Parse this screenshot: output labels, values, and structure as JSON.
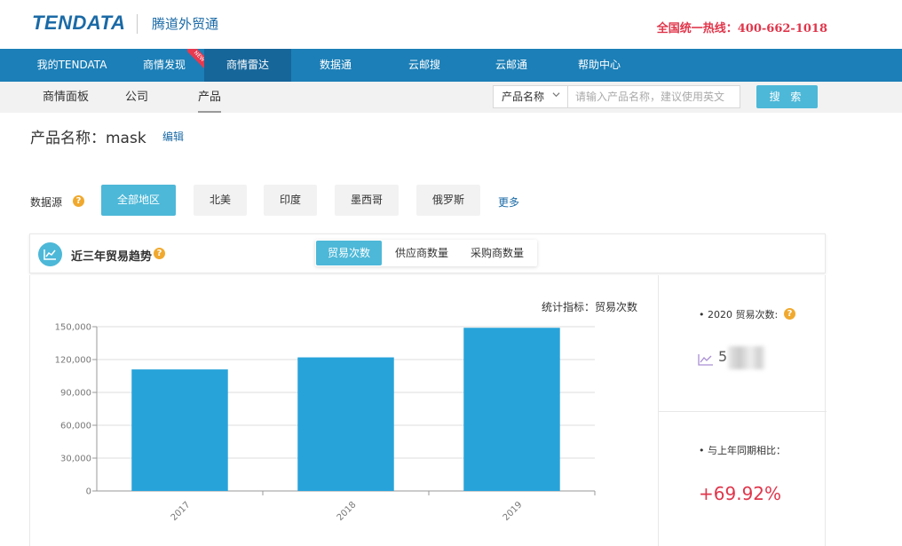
{
  "header": {
    "logo_text": "TENDATA",
    "brand_cn": "腾道外贸通",
    "hotline_label": "全国统一热线：",
    "hotline_number": "400-662-1018",
    "hotline_color": "#e0364b"
  },
  "main_nav": {
    "items": [
      {
        "label": "我的TENDATA"
      },
      {
        "label": "商情发现",
        "badge": "NEW"
      },
      {
        "label": "商情雷达",
        "active": true
      },
      {
        "label": "数据通"
      },
      {
        "label": "云邮搜"
      },
      {
        "label": "云邮通"
      },
      {
        "label": "帮助中心"
      }
    ],
    "color": "#1c7fb7"
  },
  "sub_nav": {
    "items": [
      {
        "label": "商情面板"
      },
      {
        "label": "公司"
      },
      {
        "label": "产品",
        "active": true
      }
    ]
  },
  "search": {
    "select_value": "产品名称",
    "placeholder": "请输入产品名称，建议使用英文",
    "button_label": "搜 索"
  },
  "product": {
    "title": "产品名称：mask",
    "edit_label": "编辑"
  },
  "data_source": {
    "label": "数据源",
    "regions": [
      {
        "label": "全部地区",
        "active": true
      },
      {
        "label": "北美"
      },
      {
        "label": "印度"
      },
      {
        "label": "墨西哥"
      },
      {
        "label": "俄罗斯"
      }
    ],
    "more_label": "更多"
  },
  "trend": {
    "title": "近三年贸易趋势",
    "tabs": [
      {
        "label": "贸易次数",
        "active": true
      },
      {
        "label": "供应商数量"
      },
      {
        "label": "采购商数量"
      }
    ],
    "stat_label": "统计指标：贸易次数"
  },
  "chart_data": {
    "type": "bar",
    "categories": [
      "2017",
      "2018",
      "2019"
    ],
    "values": [
      111000,
      122000,
      149000
    ],
    "ylim": [
      0,
      150000
    ],
    "yticks": [
      "0",
      "30,000",
      "60,000",
      "90,000",
      "120,000",
      "150,000"
    ],
    "grid": true,
    "bar_color": "#27a3da"
  },
  "stats": {
    "year_trades_label": "• 2020 贸易次数:",
    "year_trades_value": "5",
    "yoy_label": "• 与上年同期相比：",
    "yoy_value": "+69.92%",
    "yoy_color": "#e0364b"
  },
  "icons": {
    "help": "question-icon",
    "trend": "line-chart-icon",
    "chevron": "chevron-down-icon"
  }
}
